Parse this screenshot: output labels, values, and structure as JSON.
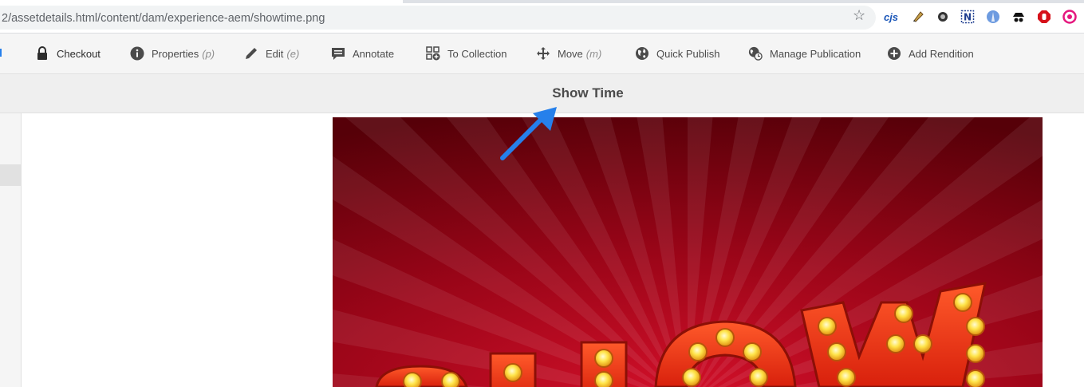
{
  "browser": {
    "url": "2/assetdetails.html/content/dam/experience-aem/showtime.png",
    "extensions": [
      "bookmark-star-icon",
      "cjs-extension-icon",
      "pen-extension-icon",
      "circle-extension-icon",
      "notion-extension-icon",
      "blue-circle-extension-icon",
      "spy-extension-icon",
      "stop-hand-extension-icon",
      "pink-eye-extension-icon"
    ],
    "cjs_label": "cjs"
  },
  "toolbar": {
    "items": [
      {
        "label": "Checkout",
        "shortcut": "",
        "icon": "lock-icon"
      },
      {
        "label": "Properties",
        "shortcut": "(p)",
        "icon": "info-icon"
      },
      {
        "label": "Edit",
        "shortcut": "(e)",
        "icon": "pencil-icon"
      },
      {
        "label": "Annotate",
        "shortcut": "",
        "icon": "comment-icon"
      },
      {
        "label": "To Collection",
        "shortcut": "",
        "icon": "add-to-collection-icon"
      },
      {
        "label": "Move",
        "shortcut": "(m)",
        "icon": "move-icon"
      },
      {
        "label": "Quick Publish",
        "shortcut": "",
        "icon": "globe-icon"
      },
      {
        "label": "Manage Publication",
        "shortcut": "",
        "icon": "globe-clock-icon"
      },
      {
        "label": "Add Rendition",
        "shortcut": "",
        "icon": "add-circle-icon"
      }
    ]
  },
  "asset": {
    "title": "Show Time"
  },
  "colors": {
    "annotation_arrow": "#2680eb",
    "toolbar_bg": "#f5f5f5",
    "title_bg": "#efefef"
  }
}
